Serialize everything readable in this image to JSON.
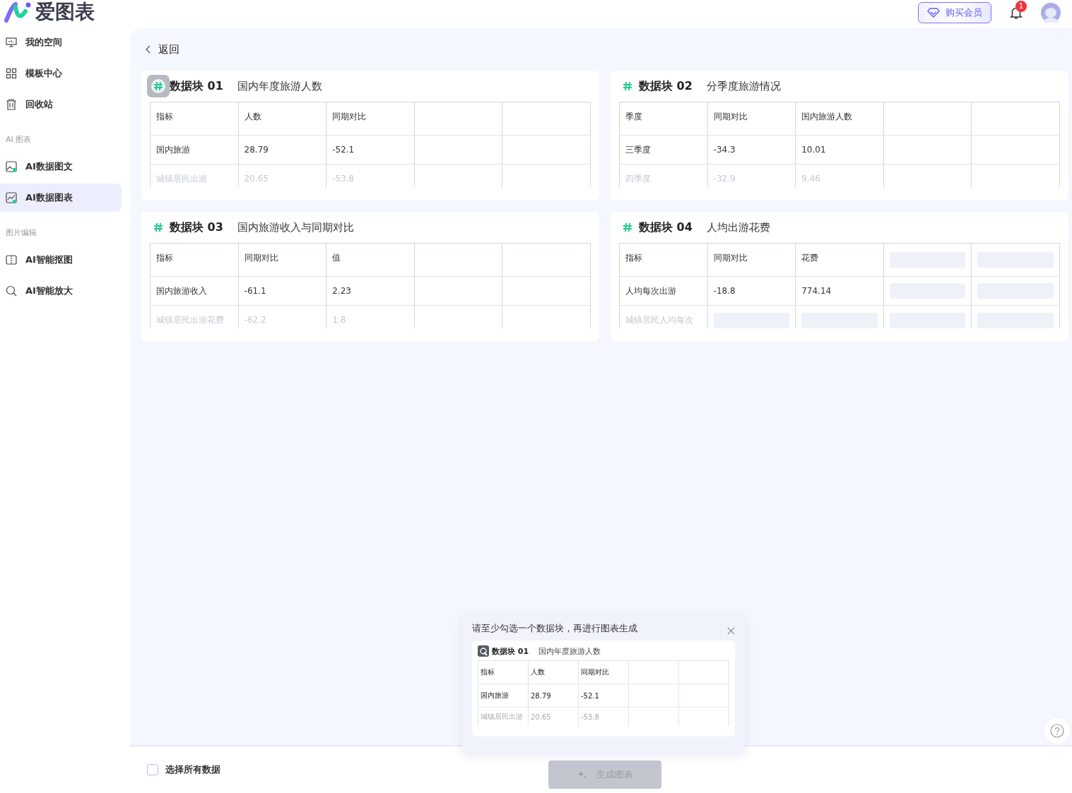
{
  "header": {
    "logo": "爱图表",
    "vip_button": "购买会员",
    "notification_count": "1"
  },
  "sidebar": {
    "items": [
      {
        "kind": "item",
        "label": "我的空间",
        "selected": false
      },
      {
        "kind": "item",
        "label": "模板中心",
        "selected": false
      },
      {
        "kind": "item",
        "label": "回收站",
        "selected": false
      },
      {
        "kind": "section",
        "label": "AI 图表"
      },
      {
        "kind": "item",
        "label": "AI数据图文",
        "selected": false
      },
      {
        "kind": "item",
        "label": "AI数据图表",
        "selected": true
      },
      {
        "kind": "section",
        "label": "图片编辑"
      },
      {
        "kind": "item",
        "label": "AI智能抠图",
        "selected": false
      },
      {
        "kind": "item",
        "label": "AI智能放大",
        "selected": false
      }
    ]
  },
  "back_link": "返回",
  "blocks": [
    {
      "name": "数据块 01",
      "title": "国内年度旅游人数",
      "hovered": true,
      "rows": [
        {
          "header": true,
          "faded": false,
          "cells": [
            "指标",
            "人数",
            "同期对比"
          ]
        },
        {
          "header": false,
          "faded": false,
          "cells": [
            "国内旅游",
            "28.79",
            "-52.1"
          ]
        },
        {
          "header": false,
          "faded": true,
          "cells": [
            "城镇居民出游",
            "20.65",
            "-53.8"
          ]
        }
      ]
    },
    {
      "name": "数据块 02",
      "title": "分季度旅游情况",
      "hovered": false,
      "rows": [
        {
          "header": true,
          "faded": false,
          "cells": [
            "季度",
            "同期对比",
            "国内旅游人数"
          ]
        },
        {
          "header": false,
          "faded": false,
          "cells": [
            "三季度",
            "-34.3",
            "10.01"
          ]
        },
        {
          "header": false,
          "faded": true,
          "cells": [
            "四季度",
            "-32.9",
            "9.46"
          ]
        }
      ]
    },
    {
      "name": "数据块 03",
      "title": "国内旅游收入与同期对比",
      "hovered": false,
      "rows": [
        {
          "header": true,
          "faded": false,
          "cells": [
            "指标",
            "同期对比",
            "值"
          ]
        },
        {
          "header": false,
          "faded": false,
          "cells": [
            "国内旅游收入",
            "-61.1",
            "2.23"
          ]
        },
        {
          "header": false,
          "faded": true,
          "cells": [
            "城镇居民出游花费",
            "-62.2",
            "1.8"
          ]
        }
      ]
    },
    {
      "name": "数据块 04",
      "title": "人均出游花费",
      "hovered": false,
      "rows": [
        {
          "header": true,
          "faded": false,
          "cells": [
            "指标",
            "同期对比",
            "花费",
            {
              "kind": "skeleton"
            },
            {
              "kind": "skeleton"
            }
          ]
        },
        {
          "header": false,
          "faded": false,
          "cells": [
            "人均每次出游",
            "-18.8",
            "774.14",
            {
              "kind": "skeleton"
            },
            {
              "kind": "skeleton"
            }
          ]
        },
        {
          "header": false,
          "faded": true,
          "cells": [
            "城镇居民人均每次",
            {
              "kind": "skeleton"
            },
            {
              "kind": "skeleton"
            },
            {
              "kind": "skeleton"
            },
            {
              "kind": "skeleton"
            }
          ]
        }
      ]
    }
  ],
  "tooltip": {
    "message": "请至少勾选一个数据块，再进行图表生成",
    "preview": {
      "name": "数据块 01",
      "title": "国内年度旅游人数",
      "rows": [
        [
          "指标",
          "人数",
          "同期对比"
        ],
        [
          "国内旅游",
          "28.79",
          "-52.1"
        ],
        [
          "城镇居民出游",
          "20.65",
          "-53.8"
        ]
      ]
    }
  },
  "footer": {
    "select_all": {
      "label": "选择所有数据",
      "checked": false
    },
    "generate_button": {
      "label": "生成图表",
      "disabled": true
    }
  }
}
